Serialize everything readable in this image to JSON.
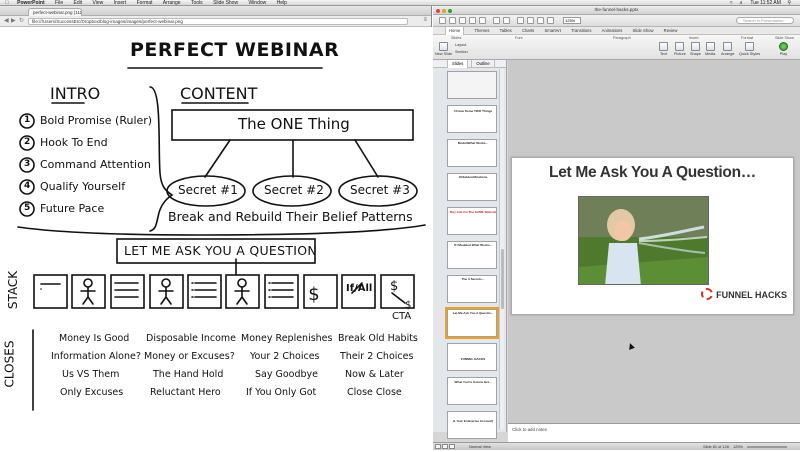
{
  "menubar": {
    "app": "PowerPoint",
    "items": [
      "File",
      "Edit",
      "View",
      "Insert",
      "Format",
      "Arrange",
      "Tools",
      "Slide Show",
      "Window",
      "Help"
    ],
    "clock": "Tue 11:52 AM"
  },
  "browser": {
    "tab_title": "perfect-webinar.png (111...",
    "url": "file:///Users/SuccessEtc/Dropbox/blog-images/images/perfect-webinar.png"
  },
  "whiteboard": {
    "title": "PERFECT WEBINAR",
    "intro_heading": "INTRO",
    "intro_items": [
      "Bold Promise (Ruler)",
      "Hook To End",
      "Command Attention",
      "Qualify Yourself",
      "Future Pace"
    ],
    "content_heading": "CONTENT",
    "one_thing": "The ONE Thing",
    "secrets": [
      "Secret #1",
      "Secret #2",
      "Secret #3"
    ],
    "belief": "Break and Rebuild Their Belief Patterns",
    "question": "LET ME ASK YOU A QUESTION",
    "stack_label": "STACK",
    "stack_box_if_all": "If/All",
    "cta": "CTA",
    "closes_label": "CLOSES",
    "closes_columns": [
      [
        "Money Is Good",
        "Information Alone?",
        "Us VS Them",
        "Only Excuses"
      ],
      [
        "Disposable Income",
        "Money or Excuses?",
        "The Hand Hold",
        "Reluctant Hero"
      ],
      [
        "Money Replenishes",
        "Your 2 Choices",
        "Say Goodbye",
        "If You Only Got"
      ],
      [
        "Break Old Habits",
        "Their 2 Choices",
        "Now & Later",
        "Close Close"
      ]
    ]
  },
  "ppt": {
    "window_title": "the-funnel-hacks.pptx",
    "zoom": "125%",
    "search_placeholder": "Search in Presentation",
    "ribbon_tabs": [
      "Home",
      "Themes",
      "Tables",
      "Charts",
      "SmartArt",
      "Transitions",
      "Animations",
      "Slide Show",
      "Review"
    ],
    "ribbon_groups": [
      "Slides",
      "Font",
      "Paragraph",
      "Insert",
      "Format",
      "Slide Show"
    ],
    "ribbon_buttons": {
      "new_slide": "New Slide",
      "layout": "Layout",
      "section": "Section",
      "text": "Text",
      "picture": "Picture",
      "shape": "Shape",
      "media": "Media",
      "arrange": "Arrange",
      "quick_styles": "Quick Styles",
      "play": "Play"
    },
    "side_tabs": [
      "Slides",
      "Outline"
    ],
    "thumbnails": [
      {
        "num": "",
        "text": ""
      },
      {
        "num": "",
        "text": "I Know Some TWO Things"
      },
      {
        "num": "",
        "text": "Model/What Works..."
      },
      {
        "num": "",
        "text": "JObsIdentifications"
      },
      {
        "num": "",
        "text": "Buy Ads On The SAME Websites!"
      },
      {
        "num": "",
        "text": "If I Modeled What Works..."
      },
      {
        "num": "",
        "text": "The 3 Secrets..."
      },
      {
        "num": "",
        "text": "Let Me Ask You A Questio..."
      },
      {
        "num": "",
        "text": "FUNNEL HACKS"
      },
      {
        "num": "",
        "text": "What You're Gonna Get..."
      },
      {
        "num": "",
        "text": "(1 Year Enterprise Account)"
      },
      {
        "num": "",
        "text": "What Our Customers Are Sayin..."
      }
    ],
    "slide": {
      "title": "Let Me Ask You A Question…",
      "logo": "FUNNEL HACKS"
    },
    "notes_placeholder": "Click to add notes",
    "status": {
      "view": "Normal View",
      "slide_count": "Slide 81 of 128",
      "zoom": "125%"
    }
  }
}
